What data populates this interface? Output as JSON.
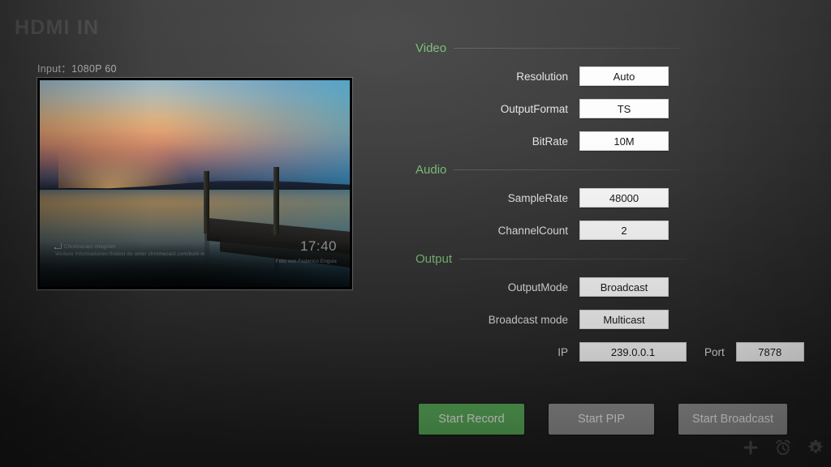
{
  "app": {
    "title": "HDMI IN"
  },
  "preview": {
    "input_label": "Input：1080P  60",
    "cast_badge_line1": "Chromecast integriert",
    "cast_badge_line2": "Weitere Informationen findest du unter chromecast.com/built-in",
    "clock": "17:40",
    "photo_credit": "Foto von Federico Enguix",
    "cast_icon": "cast-icon"
  },
  "settings": {
    "sections": [
      {
        "title": "Video",
        "fields": [
          {
            "label": "Resolution",
            "value": "Auto"
          },
          {
            "label": "OutputFormat",
            "value": "TS"
          },
          {
            "label": "BitRate",
            "value": "10M"
          }
        ]
      },
      {
        "title": "Audio",
        "fields": [
          {
            "label": "SampleRate",
            "value": "48000"
          },
          {
            "label": "ChannelCount",
            "value": "2"
          }
        ]
      },
      {
        "title": "Output",
        "fields": [
          {
            "label": "OutputMode",
            "value": "Broadcast"
          },
          {
            "label": "Broadcast mode",
            "value": "Multicast"
          }
        ],
        "network": {
          "ip_label": "IP",
          "ip_value": "239.0.0.1",
          "port_label": "Port",
          "port_value": "7878"
        }
      }
    ]
  },
  "actions": {
    "record_label": "Start Record",
    "pip_label": "Start PIP",
    "broadcast_label": "Start Broadcast"
  },
  "toolbar": {
    "icons": [
      "plus-icon",
      "alarm-clock-icon",
      "gear-icon"
    ]
  },
  "colors": {
    "accent_green": "#7dbf79",
    "record_green": "#60b860",
    "button_gray": "#9a9a9a",
    "title_gray": "#515151"
  }
}
